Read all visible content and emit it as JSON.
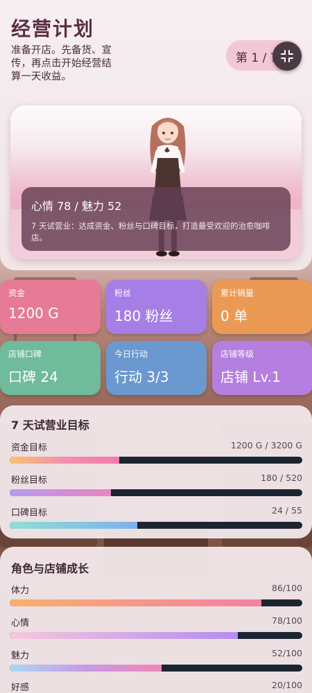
{
  "header": {
    "title": "经营计划",
    "subtitle": "准备开店。先备货、宣传，再点击开始经营结算一天收益。",
    "day_label": "第 1 / 7"
  },
  "hero": {
    "stats_line": "心情 78 / 魅力 52",
    "description": "7 天试营业：达成资金、粉丝与口碑目标，打造最受欢迎的治愈咖啡店。"
  },
  "stat_cards": [
    {
      "label": "资金",
      "value": "1200 G",
      "color": "#e77a96"
    },
    {
      "label": "粉丝",
      "value": "180 粉丝",
      "color": "#a67fe6"
    },
    {
      "label": "累计销量",
      "value": "0 单",
      "color": "#eb9a55"
    },
    {
      "label": "店铺口碑",
      "value": "口碑 24",
      "color": "#6fbb9b"
    },
    {
      "label": "今日行动",
      "value": "行动 3/3",
      "color": "#6a98cf"
    },
    {
      "label": "店铺等级",
      "value": "店铺 Lv.1",
      "color": "#b47fe0"
    }
  ],
  "goals": {
    "title": "7 天试营业目标",
    "items": [
      {
        "label": "资金目标",
        "value": "1200 G / 3200 G",
        "progress": 0.375,
        "gradient": "linear-gradient(90deg,#f8c26e,#f28fb0,#f37ba8)"
      },
      {
        "label": "粉丝目标",
        "value": "180 / 520",
        "progress": 0.346,
        "gradient": "linear-gradient(90deg,#b79af0,#e983c2)"
      },
      {
        "label": "口碑目标",
        "value": "24 / 55",
        "progress": 0.436,
        "gradient": "linear-gradient(90deg,#8ee0d2,#7fb0ef)"
      }
    ]
  },
  "growth": {
    "title": "角色与店铺成长",
    "items": [
      {
        "label": "体力",
        "value": "86/100",
        "progress": 0.86,
        "gradient": "linear-gradient(90deg,#f9b06a,#f47fa3)"
      },
      {
        "label": "心情",
        "value": "78/100",
        "progress": 0.78,
        "gradient": "linear-gradient(90deg,#f6c7dc,#b48df0)"
      },
      {
        "label": "魅力",
        "value": "52/100",
        "progress": 0.52,
        "gradient": "linear-gradient(90deg,#a9d8f2,#c79ae8,#f086b9)"
      },
      {
        "label": "好感",
        "value": "20/100",
        "progress": 0.2,
        "gradient": "linear-gradient(90deg,#f6a3c2,#e889c0)"
      }
    ]
  }
}
